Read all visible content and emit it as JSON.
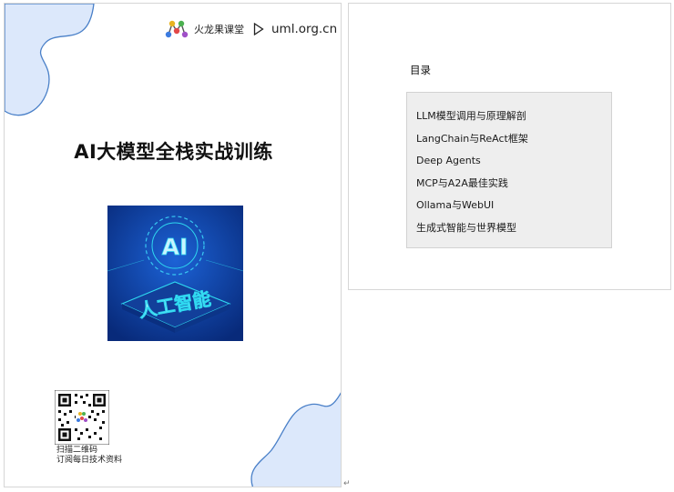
{
  "cover": {
    "brand_name": "火龙果课堂",
    "brand_url": "uml.org.cn",
    "title": "AI大模型全栈实战训练",
    "image_text_top": "AI",
    "image_text_main": "人工智能",
    "qr_caption_line1": "扫描二维码",
    "qr_caption_line2": "订阅每日技术资料",
    "colors": {
      "wave": "#dce8fb",
      "wave_stroke": "#4a80c8",
      "image_bg": "#0d3a9a",
      "image_glow": "#2ed8f0"
    }
  },
  "toc": {
    "heading": "目录",
    "items": [
      "LLM模型调用与原理解剖",
      "LangChain与ReAct框架",
      "Deep Agents",
      "MCP与A2A最佳实践",
      "Ollama与WebUI",
      "生成式智能与世界模型"
    ]
  },
  "paragraph_mark": "↵"
}
